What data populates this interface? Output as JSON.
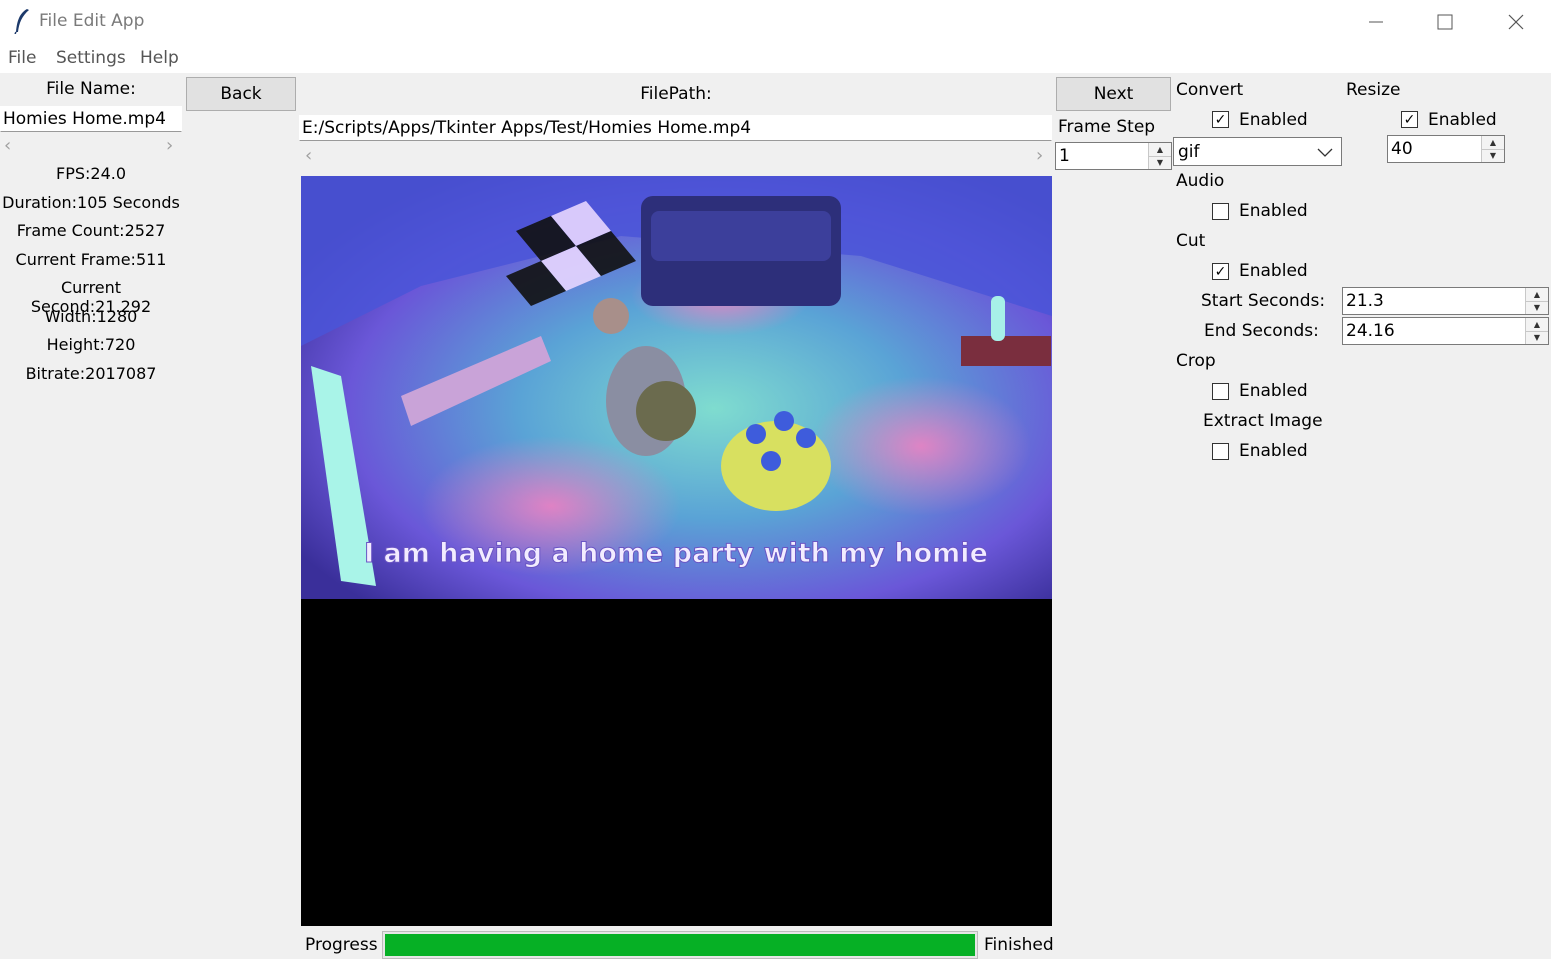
{
  "window": {
    "title": "File Edit App"
  },
  "menu": {
    "file": "File",
    "settings": "Settings",
    "help": "Help"
  },
  "left": {
    "file_name_label": "File Name:",
    "file_name_value": "Homies Home.mp4",
    "info": {
      "fps": "FPS:24.0",
      "duration": "Duration:105 Seconds",
      "frame_count": "Frame Count:2527",
      "current_frame": "Current Frame:511",
      "current_second": "Current Second:21.292",
      "width": "Width:1280",
      "height": "Height:720",
      "bitrate": "Bitrate:2017087"
    }
  },
  "nav": {
    "back": "Back",
    "next": "Next"
  },
  "center": {
    "filepath_label": "FilePath:",
    "filepath_value": "E:/Scripts/Apps/Tkinter Apps/Test/Homies Home.mp4",
    "subtitle": "I am having a home party with my homie"
  },
  "frame_step": {
    "label": "Frame Step",
    "value": "1"
  },
  "convert": {
    "label": "Convert",
    "enabled_label": "Enabled",
    "enabled": true,
    "format": "gif"
  },
  "resize": {
    "label": "Resize",
    "enabled_label": "Enabled",
    "enabled": true,
    "value": "40"
  },
  "audio": {
    "label": "Audio",
    "enabled_label": "Enabled",
    "enabled": false
  },
  "cut": {
    "label": "Cut",
    "enabled_label": "Enabled",
    "enabled": true,
    "start_label": "Start Seconds:",
    "start_value": "21.3",
    "end_label": "End Seconds:",
    "end_value": "24.16"
  },
  "crop": {
    "label": "Crop",
    "enabled_label": "Enabled",
    "enabled": false
  },
  "extract_image": {
    "label": "Extract Image",
    "enabled_label": "Enabled",
    "enabled": false
  },
  "progress": {
    "label": "Progress",
    "status": "Finished",
    "value_percent": 100,
    "color": "#06b025"
  },
  "icons": {
    "checkmark": "✓",
    "close": "✕",
    "minimize": "—",
    "maximize": "☐"
  }
}
